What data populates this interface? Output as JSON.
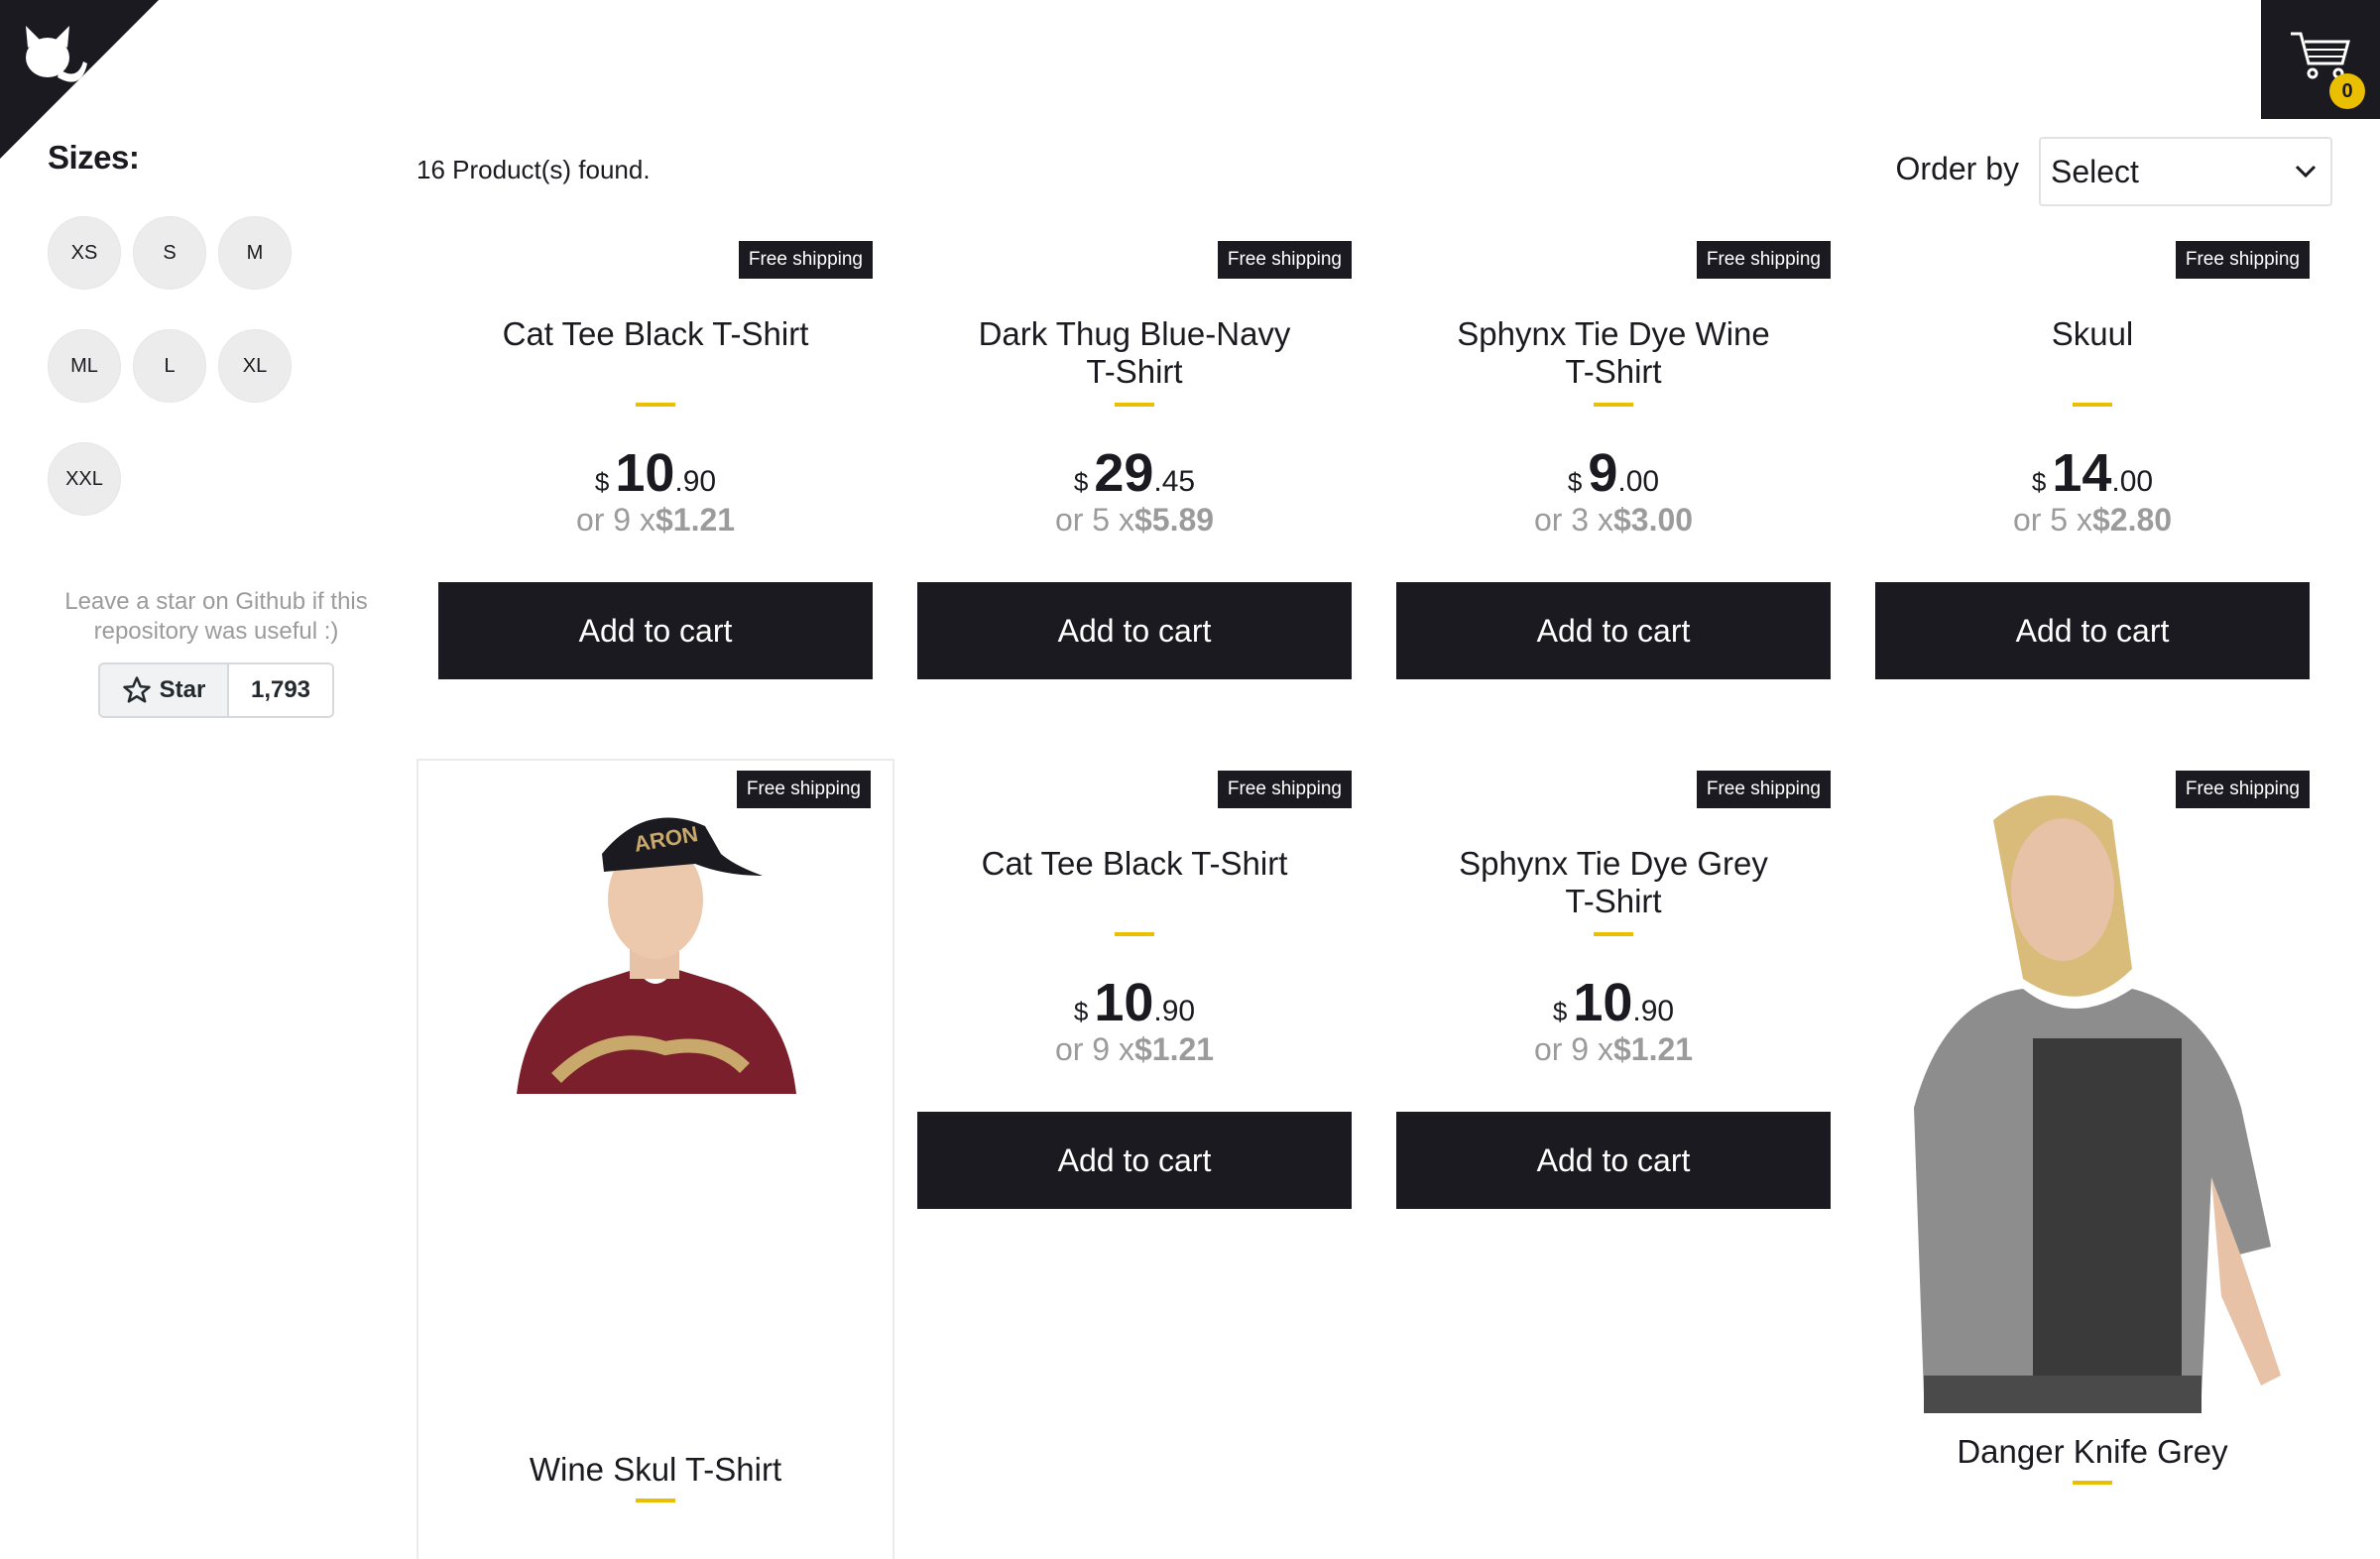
{
  "filters": {
    "title": "Sizes:",
    "sizes": [
      "XS",
      "S",
      "M",
      "ML",
      "L",
      "XL",
      "XXL"
    ]
  },
  "github": {
    "note": "Leave a star on Github if this repository was useful :)",
    "star_label": "Star",
    "star_count": "1,793"
  },
  "cart": {
    "quantity": "0"
  },
  "shelf": {
    "found_text": "16 Product(s) found.",
    "order_label": "Order by",
    "order_value": "Select"
  },
  "colors": {
    "accent": "#eabf00",
    "dark": "#1b1a20",
    "muted": "#9c9b9b"
  },
  "products": [
    {
      "title": "Cat Tee Black T-Shirt",
      "badge": "Free shipping",
      "currency": "$",
      "price_int": "10",
      "price_dec": ".90",
      "inst_prefix": "or 9 x",
      "inst_value": "$1.21",
      "button": "Add to cart"
    },
    {
      "title": "Dark Thug Blue-Navy T-Shirt",
      "badge": "Free shipping",
      "currency": "$",
      "price_int": "29",
      "price_dec": ".45",
      "inst_prefix": "or 5 x",
      "inst_value": "$5.89",
      "button": "Add to cart"
    },
    {
      "title": "Sphynx Tie Dye Wine T-Shirt",
      "badge": "Free shipping",
      "currency": "$",
      "price_int": "9",
      "price_dec": ".00",
      "inst_prefix": "or 3 x",
      "inst_value": "$3.00",
      "button": "Add to cart"
    },
    {
      "title": "Skuul",
      "badge": "Free shipping",
      "currency": "$",
      "price_int": "14",
      "price_dec": ".00",
      "inst_prefix": "or 5 x",
      "inst_value": "$2.80",
      "button": "Add to cart"
    },
    {
      "title": "Wine Skul T-Shirt",
      "badge": "Free shipping",
      "image": "man-in-cap-wine-tshirt"
    },
    {
      "title": "Cat Tee Black T-Shirt",
      "badge": "Free shipping",
      "currency": "$",
      "price_int": "10",
      "price_dec": ".90",
      "inst_prefix": "or 9 x",
      "inst_value": "$1.21",
      "button": "Add to cart"
    },
    {
      "title": "Sphynx Tie Dye Grey T-Shirt",
      "badge": "Free shipping",
      "currency": "$",
      "price_int": "10",
      "price_dec": ".90",
      "inst_prefix": "or 9 x",
      "inst_value": "$1.21",
      "button": "Add to cart"
    },
    {
      "title": "Danger Knife Grey",
      "badge": "Free shipping",
      "image": "man-long-hair-grey-tshirt"
    }
  ]
}
